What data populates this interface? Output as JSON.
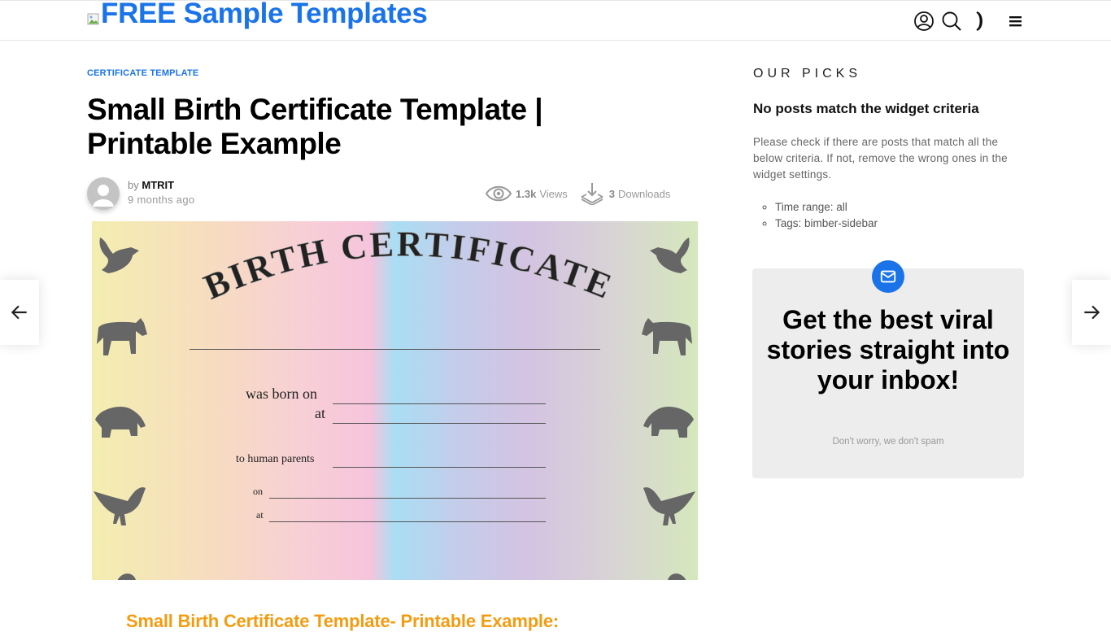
{
  "header": {
    "site_name": "FREE Sample Templates",
    "icons": [
      "user-icon",
      "search-icon",
      "dark-mode-icon",
      "menu-icon"
    ]
  },
  "article": {
    "category": "CERTIFICATE TEMPLATE",
    "title": "Small Birth Certificate Template | Printable Example",
    "author_prefix": "by",
    "author": "MTRIT",
    "date": "9 months ago",
    "views_count": "1.3k",
    "views_label": "Views",
    "downloads_count": "3",
    "downloads_label": "Downloads",
    "image": {
      "heading": "BIRTH CERTIFICATE",
      "labels": {
        "born_on": "was born on",
        "at1": "at",
        "parents": "to human parents",
        "on": "on",
        "at2": "at"
      }
    },
    "subheading": "Small Birth Certificate Template- Printable Example:"
  },
  "navigation": {
    "prev_icon": "arrow-left-icon",
    "next_icon": "arrow-right-icon"
  },
  "sidebar": {
    "heading": "OUR PICKS",
    "empty_title": "No posts match the widget criteria",
    "empty_text": "Please check if there are posts that match all the below criteria. If not, remove the wrong ones in the widget settings.",
    "criteria": [
      "Time range: all",
      "Tags: bimber-sidebar"
    ],
    "newsletter": {
      "title": "Get the best viral stories straight into your inbox!",
      "note": "Don't worry, we don't spam"
    }
  },
  "colors": {
    "brand": "#1a73e8",
    "subheading": "#f39c12"
  }
}
